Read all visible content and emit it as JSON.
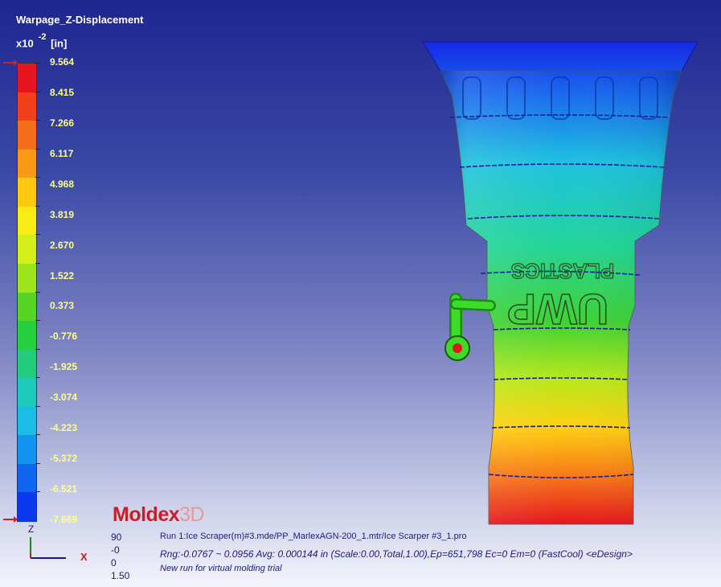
{
  "result": {
    "title": "Warpage_Z-Displacement",
    "scale_label": "x10",
    "exponent": "-2",
    "unit": "[in]"
  },
  "legend": {
    "ticks": [
      "9.564",
      "8.415",
      "7.266",
      "6.117",
      "4.968",
      "3.819",
      "2.670",
      "1.522",
      "0.373",
      "-0.776",
      "-1.925",
      "-3.074",
      "-4.223",
      "-5.372",
      "-6.521",
      "-7.669"
    ],
    "colors": [
      "#e8141e",
      "#f2401b",
      "#f76e18",
      "#fa9a14",
      "#ffc811",
      "#f8ec12",
      "#d4ee18",
      "#9ee41c",
      "#58d522",
      "#27d03e",
      "#22cc7c",
      "#1ecaba",
      "#19bde6",
      "#1494ef",
      "#0f66ef",
      "#0a39ef"
    ]
  },
  "model": {
    "logo_line1": "UWP",
    "logo_line2": "PLASTICS"
  },
  "brand": {
    "name": "Moldex",
    "suffix": "3D"
  },
  "axis": {
    "z": "Z",
    "x": "X"
  },
  "info": {
    "view_values": [
      "90",
      "-0",
      "0",
      "1.50"
    ],
    "run_line": "Run 1:Ice Scraper(m)#3.mde/PP_MarlexAGN-200_1.mtr/Ice Scarper #3_1.pro",
    "range_line": "Rng:-0.0767 ~ 0.0956  Avg: 0.000144 in (Scale:0.00,Total,1.00),Ep=651,798 Ec=0 Em=0 (FastCool) <eDesign>",
    "note_line": "New run for virtual molding trial"
  }
}
